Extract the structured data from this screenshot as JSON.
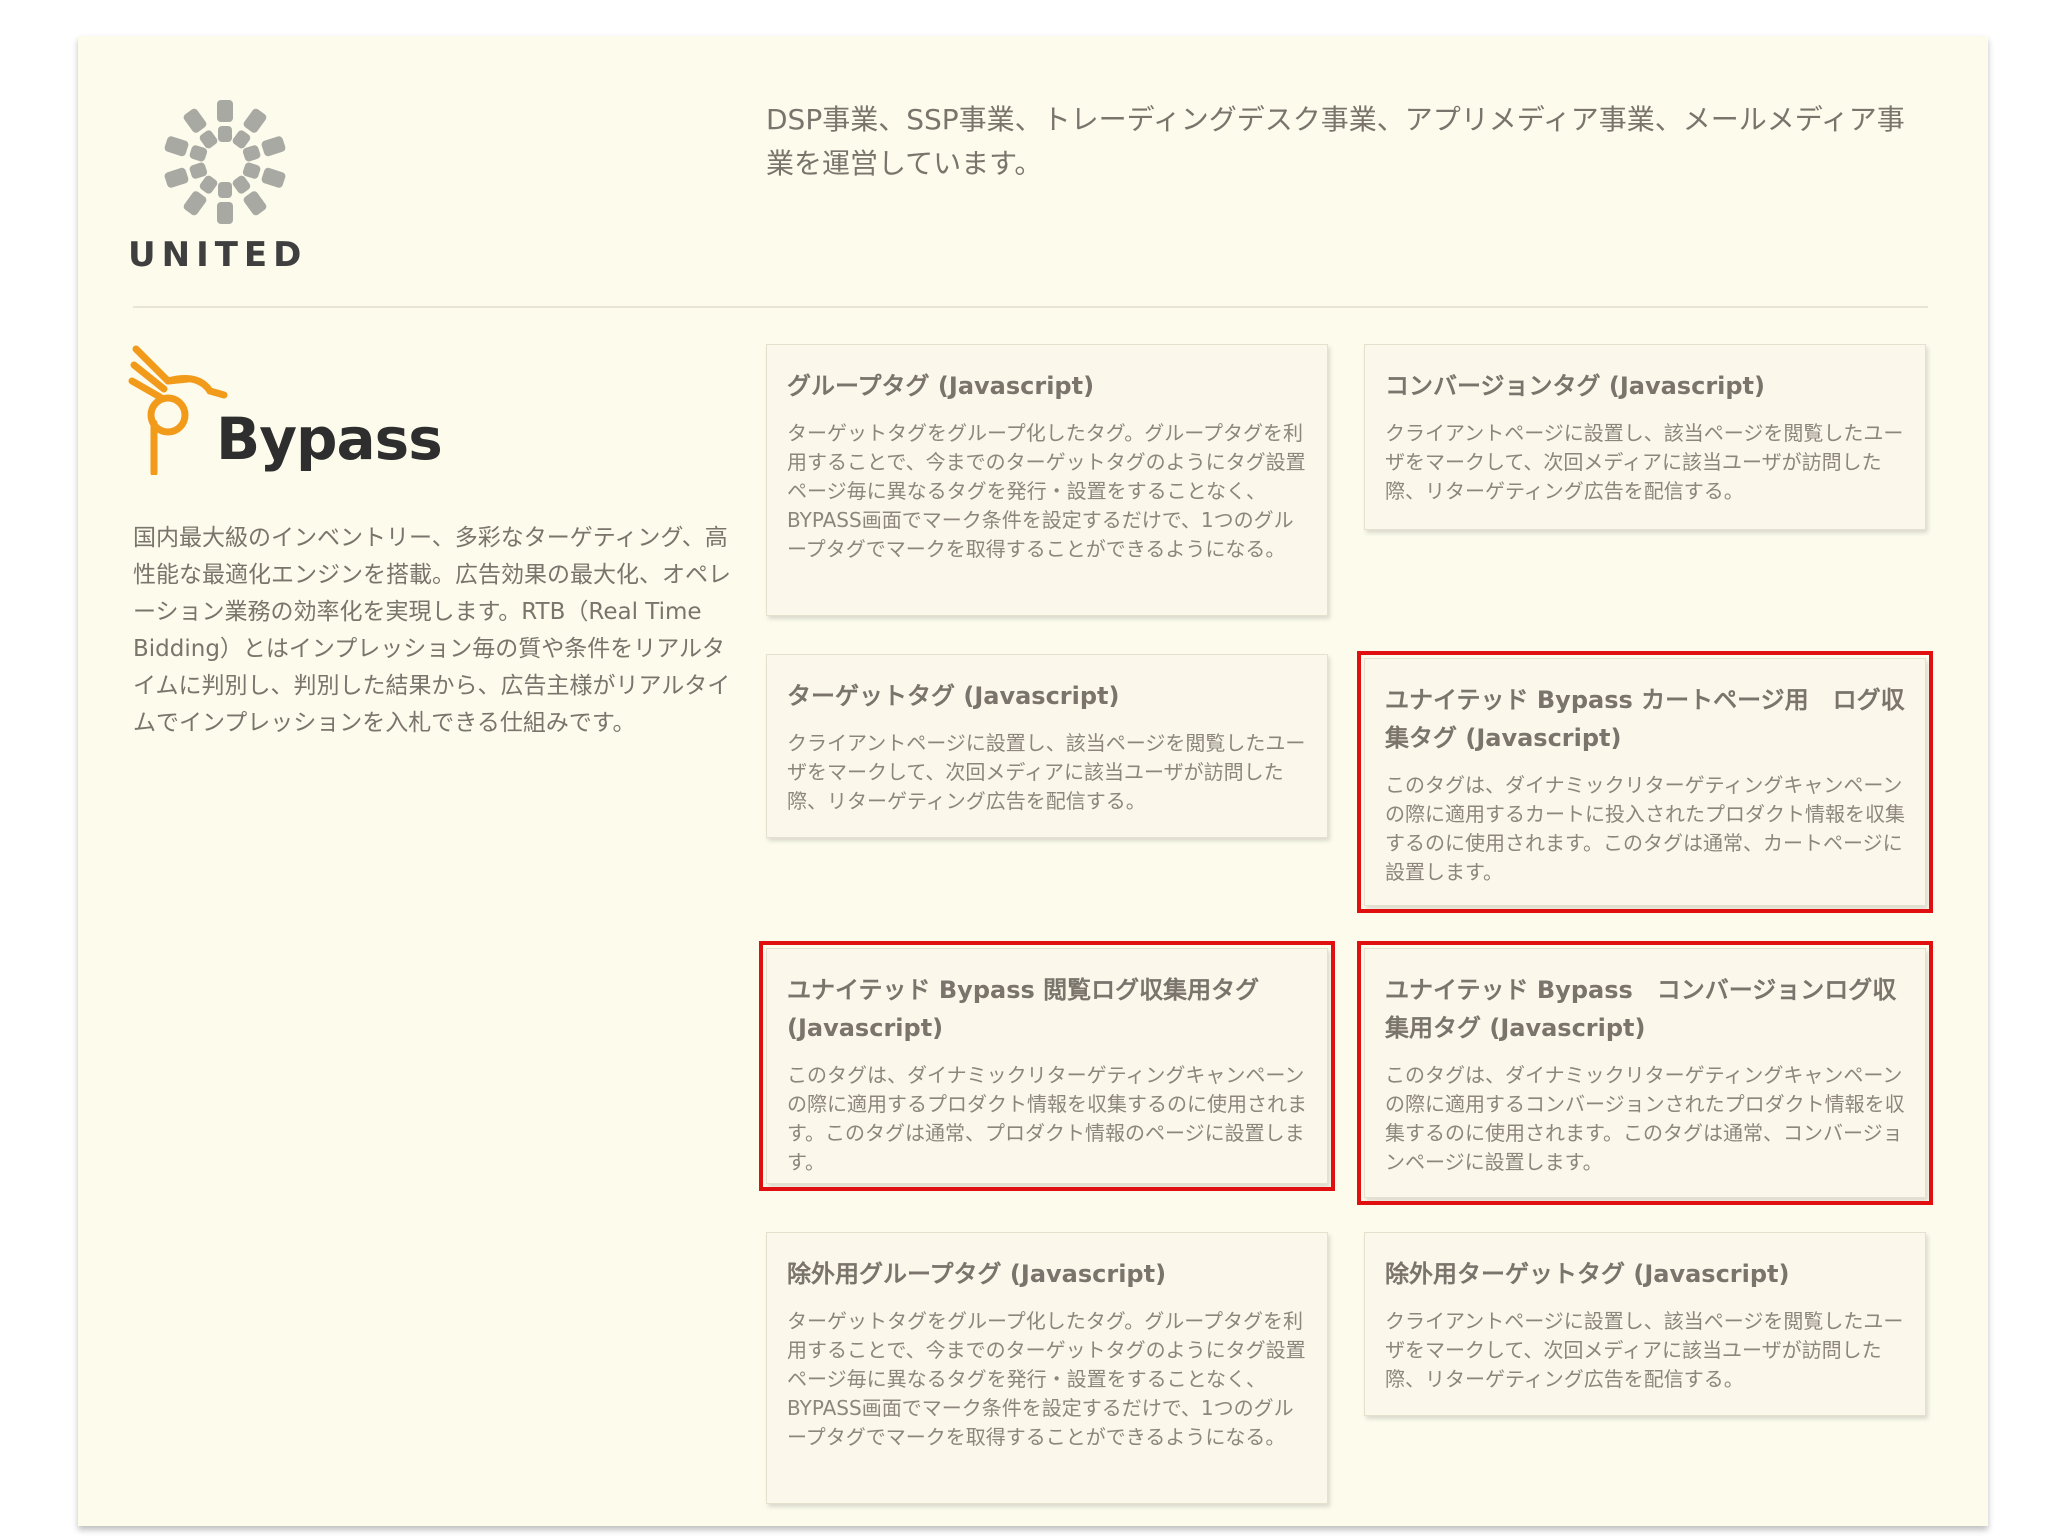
{
  "header": {
    "company_name": "UNITED",
    "intro": "DSP事業、SSP事業、トレーディングデスク事業、アプリメディア事業、メールメディア事業を運営しています。"
  },
  "product": {
    "name": "Bypass",
    "description": "国内最大級のインベントリー、多彩なターゲティング、高性能な最適化エンジンを搭載。広告効果の最大化、オペレーション業務の効率化を実現します。RTB（Real Time Bidding）とはインプレッション毎の質や条件をリアルタイムに判別し、判別した結果から、広告主様がリアルタイムでインプレッションを入札できる仕組みです。"
  },
  "cards": [
    {
      "title": "グループタグ (Javascript)",
      "body": "ターゲットタグをグループ化したタグ。グループタグを利用することで、今までのターゲットタグのようにタグ設置ページ毎に異なるタグを発行・設置をすることなく、BYPASS画面でマーク条件を設定するだけで、1つのグループタグでマークを取得することができるようになる。"
    },
    {
      "title": "コンバージョンタグ (Javascript)",
      "body": "クライアントページに設置し、該当ページを閲覧したユーザをマークして、次回メディアに該当ユーザが訪問した際、リターゲティング広告を配信する。"
    },
    {
      "title": "ターゲットタグ (Javascript)",
      "body": "クライアントページに設置し、該当ページを閲覧したユーザをマークして、次回メディアに該当ユーザが訪問した際、リターゲティング広告を配信する。"
    },
    {
      "title": "ユナイテッド Bypass カートページ用　ログ収集タグ (Javascript)",
      "body": "このタグは、ダイナミックリターゲティングキャンペーンの際に適用するカートに投入されたプロダクト情報を収集するのに使用されます。このタグは通常、カートページに設置します。"
    },
    {
      "title": "ユナイテッド Bypass 閲覧ログ収集用タグ (Javascript)",
      "body": "このタグは、ダイナミックリターゲティングキャンペーンの際に適用するプロダクト情報を収集するのに使用されます。このタグは通常、プロダクト情報のページに設置します。"
    },
    {
      "title": "ユナイテッド Bypass　コンバージョンログ収集用タグ (Javascript)",
      "body": "このタグは、ダイナミックリターゲティングキャンペーンの際に適用するコンバージョンされたプロダクト情報を収集するのに使用されます。このタグは通常、コンバージョンページに設置します。"
    },
    {
      "title": "除外用グループタグ (Javascript)",
      "body": "ターゲットタグをグループ化したタグ。グループタグを利用することで、今までのターゲットタグのようにタグ設置ページ毎に異なるタグを発行・設置をすることなく、BYPASS画面でマーク条件を設定するだけで、1つのグループタグでマークを取得することができるようになる。"
    },
    {
      "title": "除外用ターゲットタグ (Javascript)",
      "body": "クライアントページに設置し、該当ページを閲覧したユーザをマークして、次回メディアに該当ユーザが訪問した際、リターゲティング広告を配信する。"
    }
  ],
  "colors": {
    "panel_bg": "#fcfbec",
    "card_bg": "#fbf7ea",
    "highlight": "#e11010",
    "bypass_orange": "#f29a1a"
  }
}
